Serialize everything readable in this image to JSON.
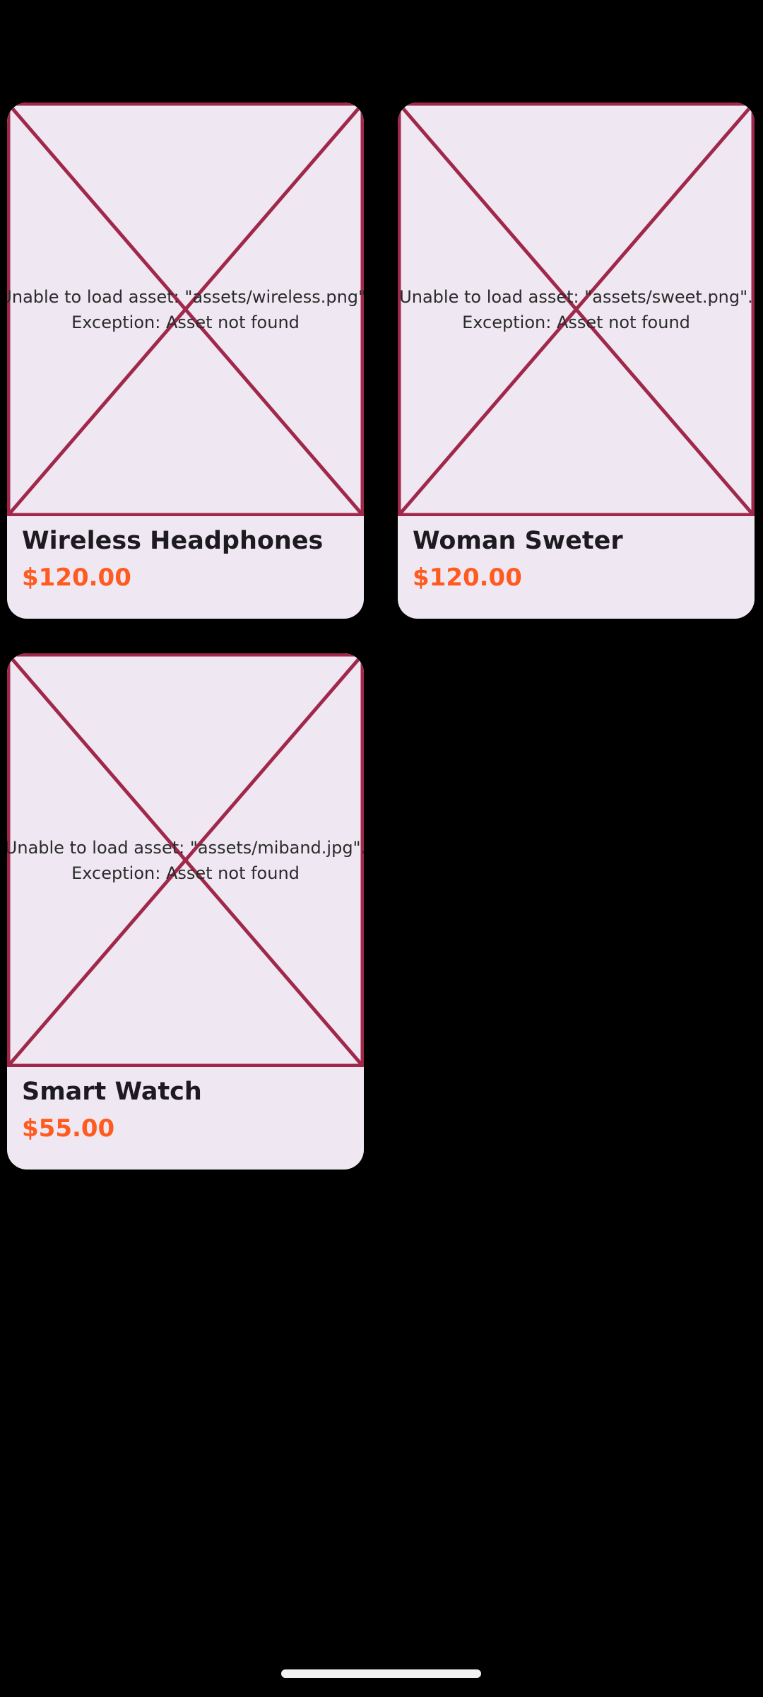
{
  "products": [
    {
      "title": "Wireless Headphones",
      "price": "$120.00",
      "error_line1": "Unable to load asset: \"assets/wireless.png\".",
      "error_line2": "Exception: Asset not found"
    },
    {
      "title": "Woman Sweter",
      "price": "$120.00",
      "error_line1": "Unable to load asset: \"assets/sweet.png\".",
      "error_line2": "Exception: Asset not found"
    },
    {
      "title": "Smart Watch",
      "price": "$55.00",
      "error_line1": "Unable to load asset: \"assets/miband.jpg\".",
      "error_line2": "Exception: Asset not found"
    }
  ],
  "colors": {
    "background": "#000000",
    "card_background": "#efe8f2",
    "error_outline": "#a0284a",
    "price": "#ff5a1f",
    "title": "#1d1b20",
    "home_indicator": "#f2f2f2"
  },
  "icons": {
    "image_error": "broken-image-x-icon"
  }
}
